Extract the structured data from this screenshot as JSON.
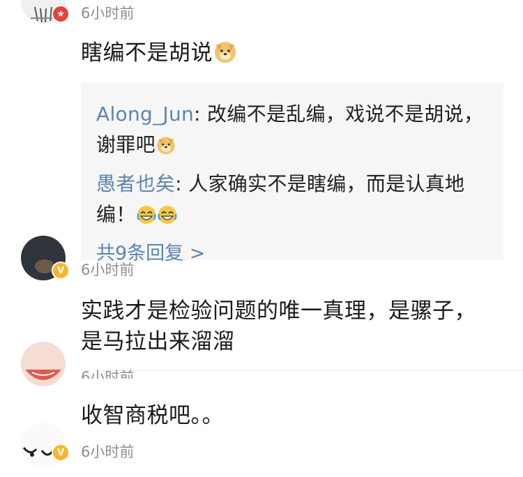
{
  "comments": [
    {
      "time": "6小时前",
      "text": "瞎编不是胡说",
      "emoji": "dog-face-emoji",
      "replies": [
        {
          "user": "Along_Jun",
          "sep": ": ",
          "text": "改编不是乱编，戏说不是胡说，谢罪吧"
        },
        {
          "user": "愚者也矣",
          "sep": ": ",
          "text": "人家确实不是瞎编，而是认真地编！"
        }
      ],
      "more_replies": "共9条回复 >"
    },
    {
      "time": "6小时前",
      "text": "实践才是检验问题的唯一真理，是骡子，是马拉出来溜溜"
    },
    {
      "time": "6小时前",
      "text": "收智商税吧。。"
    },
    {
      "time": "6小时前"
    }
  ],
  "colors": {
    "username": "#5b85b2",
    "reply_bg": "#f6f6f6",
    "timestamp": "#8e8e8e",
    "badge_red": "#e8413e",
    "badge_gold": "#f6b52a"
  }
}
